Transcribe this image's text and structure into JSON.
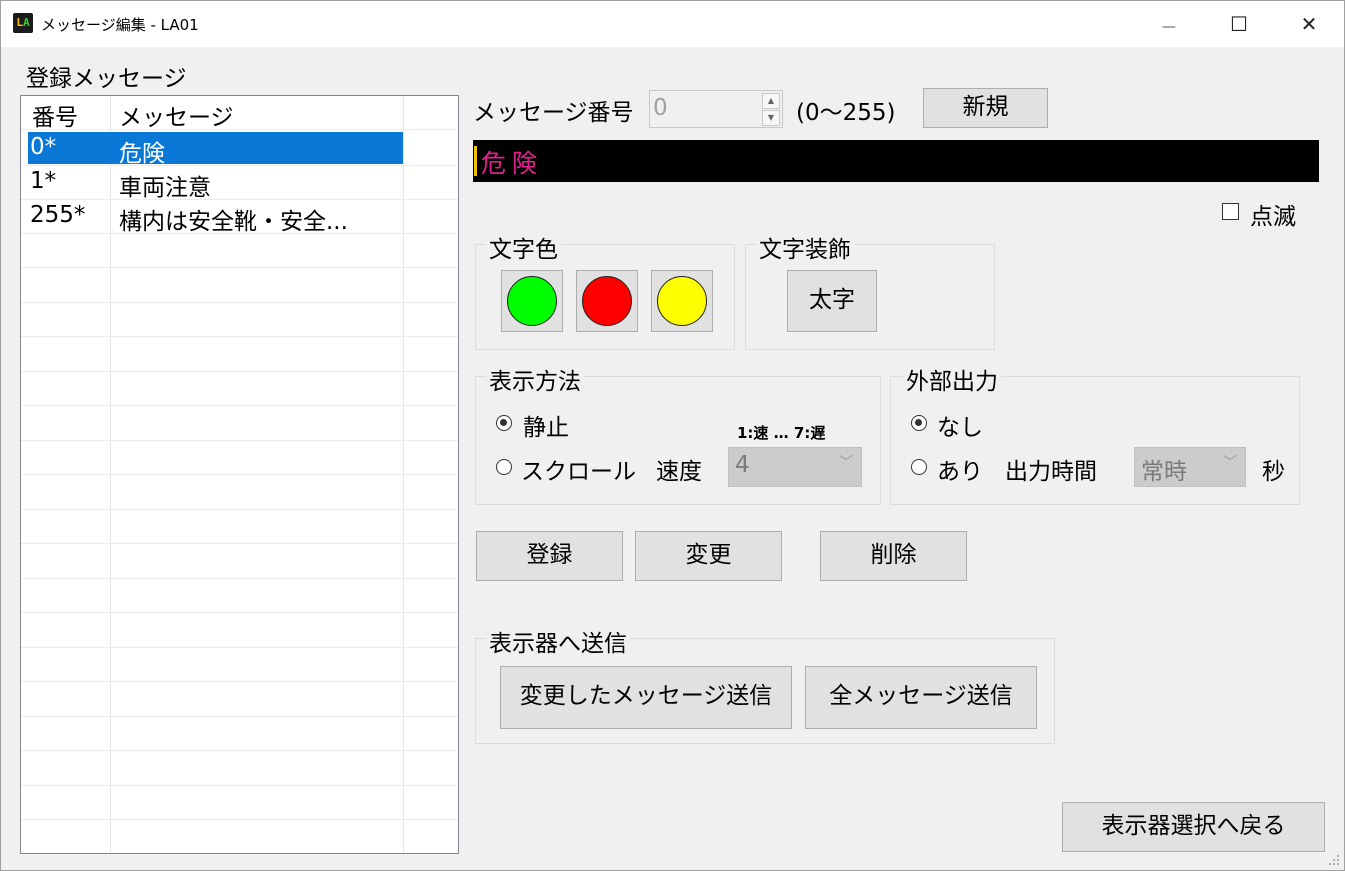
{
  "window": {
    "title": "メッセージ編集 - LA01",
    "icon": "app-icon",
    "minimize": "—",
    "maximize": "☐",
    "close": "✕"
  },
  "list": {
    "caption": "登録メッセージ",
    "headers": [
      "番号",
      "メッセージ"
    ],
    "rows": [
      {
        "no": "0*",
        "message": "危険",
        "selected": true
      },
      {
        "no": "1*",
        "message": "車両注意",
        "selected": false
      },
      {
        "no": "255*",
        "message": "構内は安全靴・安全...",
        "selected": false
      }
    ]
  },
  "editor": {
    "number_label": "メッセージ番号",
    "number_value": "0",
    "range_text": "(0〜255)",
    "new_button": "新規",
    "preview_text": "危険",
    "preview_color": "#e0208c",
    "blink_label": "点滅",
    "blink_checked": false
  },
  "text_color": {
    "title": "文字色",
    "colors": [
      "#00ff00",
      "#ff0000",
      "#ffff00"
    ]
  },
  "text_decoration": {
    "title": "文字装飾",
    "bold_button": "太字"
  },
  "display_method": {
    "title": "表示方法",
    "speed_hint": "1:速 … 7:遅",
    "static_label": "静止",
    "scroll_label": "スクロール",
    "speed_label": "速度",
    "speed_value": "4",
    "selected": "static"
  },
  "external_output": {
    "title": "外部出力",
    "none_label": "なし",
    "yes_label": "あり",
    "time_label": "出力時間",
    "time_value": "常時",
    "unit": "秒",
    "selected": "none"
  },
  "actions": {
    "register": "登録",
    "change": "変更",
    "delete": "削除"
  },
  "send": {
    "title": "表示器へ送信",
    "send_changed": "変更したメッセージ送信",
    "send_all": "全メッセージ送信"
  },
  "back_button": "表示器選択へ戻る"
}
